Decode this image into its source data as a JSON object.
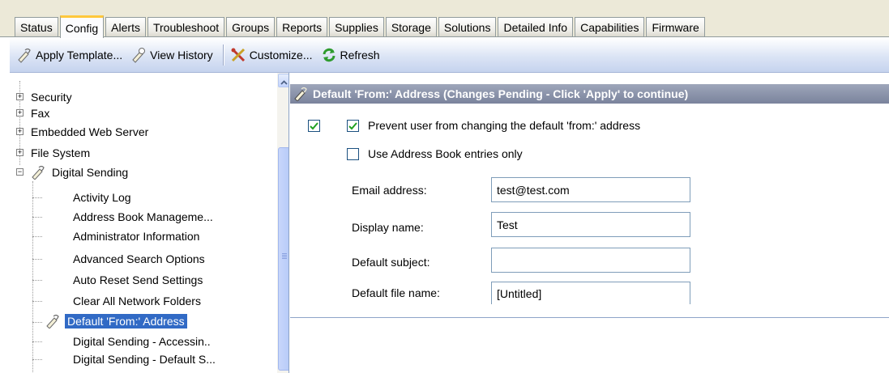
{
  "tabs": [
    {
      "label": "Status",
      "active": false
    },
    {
      "label": "Config",
      "active": true
    },
    {
      "label": "Alerts",
      "active": false
    },
    {
      "label": "Troubleshoot",
      "active": false
    },
    {
      "label": "Groups",
      "active": false
    },
    {
      "label": "Reports",
      "active": false
    },
    {
      "label": "Supplies",
      "active": false
    },
    {
      "label": "Storage",
      "active": false
    },
    {
      "label": "Solutions",
      "active": false
    },
    {
      "label": "Detailed Info",
      "active": false
    },
    {
      "label": "Capabilities",
      "active": false
    },
    {
      "label": "Firmware",
      "active": false
    }
  ],
  "toolbar": {
    "apply_template": "Apply Template...",
    "view_history": "View History",
    "customize": "Customize...",
    "refresh": "Refresh"
  },
  "tree": {
    "items": [
      {
        "label": "Security"
      },
      {
        "label": "Fax"
      },
      {
        "label": "Embedded Web Server"
      },
      {
        "label": "File System"
      },
      {
        "label": "Digital Sending"
      },
      {
        "label": "Activity Log"
      },
      {
        "label": "Address Book Manageme..."
      },
      {
        "label": "Administrator Information"
      },
      {
        "label": "Advanced Search Options"
      },
      {
        "label": "Auto Reset Send Settings"
      },
      {
        "label": "Clear All Network Folders"
      },
      {
        "label": "Default 'From:' Address"
      },
      {
        "label": "Digital Sending - Accessin.."
      },
      {
        "label": "Digital Sending - Default S..."
      }
    ]
  },
  "panel": {
    "header": "Default 'From:' Address (Changes Pending - Click 'Apply' to continue)",
    "enabled_checked": true,
    "prevent_user_label": "Prevent user from changing the default 'from:' address",
    "prevent_user_checked": true,
    "address_book_label": "Use Address Book entries only",
    "address_book_checked": false,
    "fields": {
      "email_label": "Email address:",
      "email_value": "test@test.com",
      "display_label": "Display name:",
      "display_value": "Test",
      "subject_label": "Default subject:",
      "subject_value": "",
      "filename_label": "Default file name:",
      "filename_value": "[Untitled]"
    }
  },
  "colors": {
    "selection": "#316ac5",
    "header_bg": "#8b93aa",
    "active_tab_accent": "#ffc83c",
    "toolbar": "#dbe4f5"
  },
  "icons": {
    "apply_template": "template-wand-icon",
    "view_history": "history-wand-icon",
    "customize": "customize-tools-icon",
    "refresh": "refresh-arrows-icon",
    "digital_sending": "digital-sending-wand-icon",
    "scroll_up": "chevron-up-icon"
  }
}
